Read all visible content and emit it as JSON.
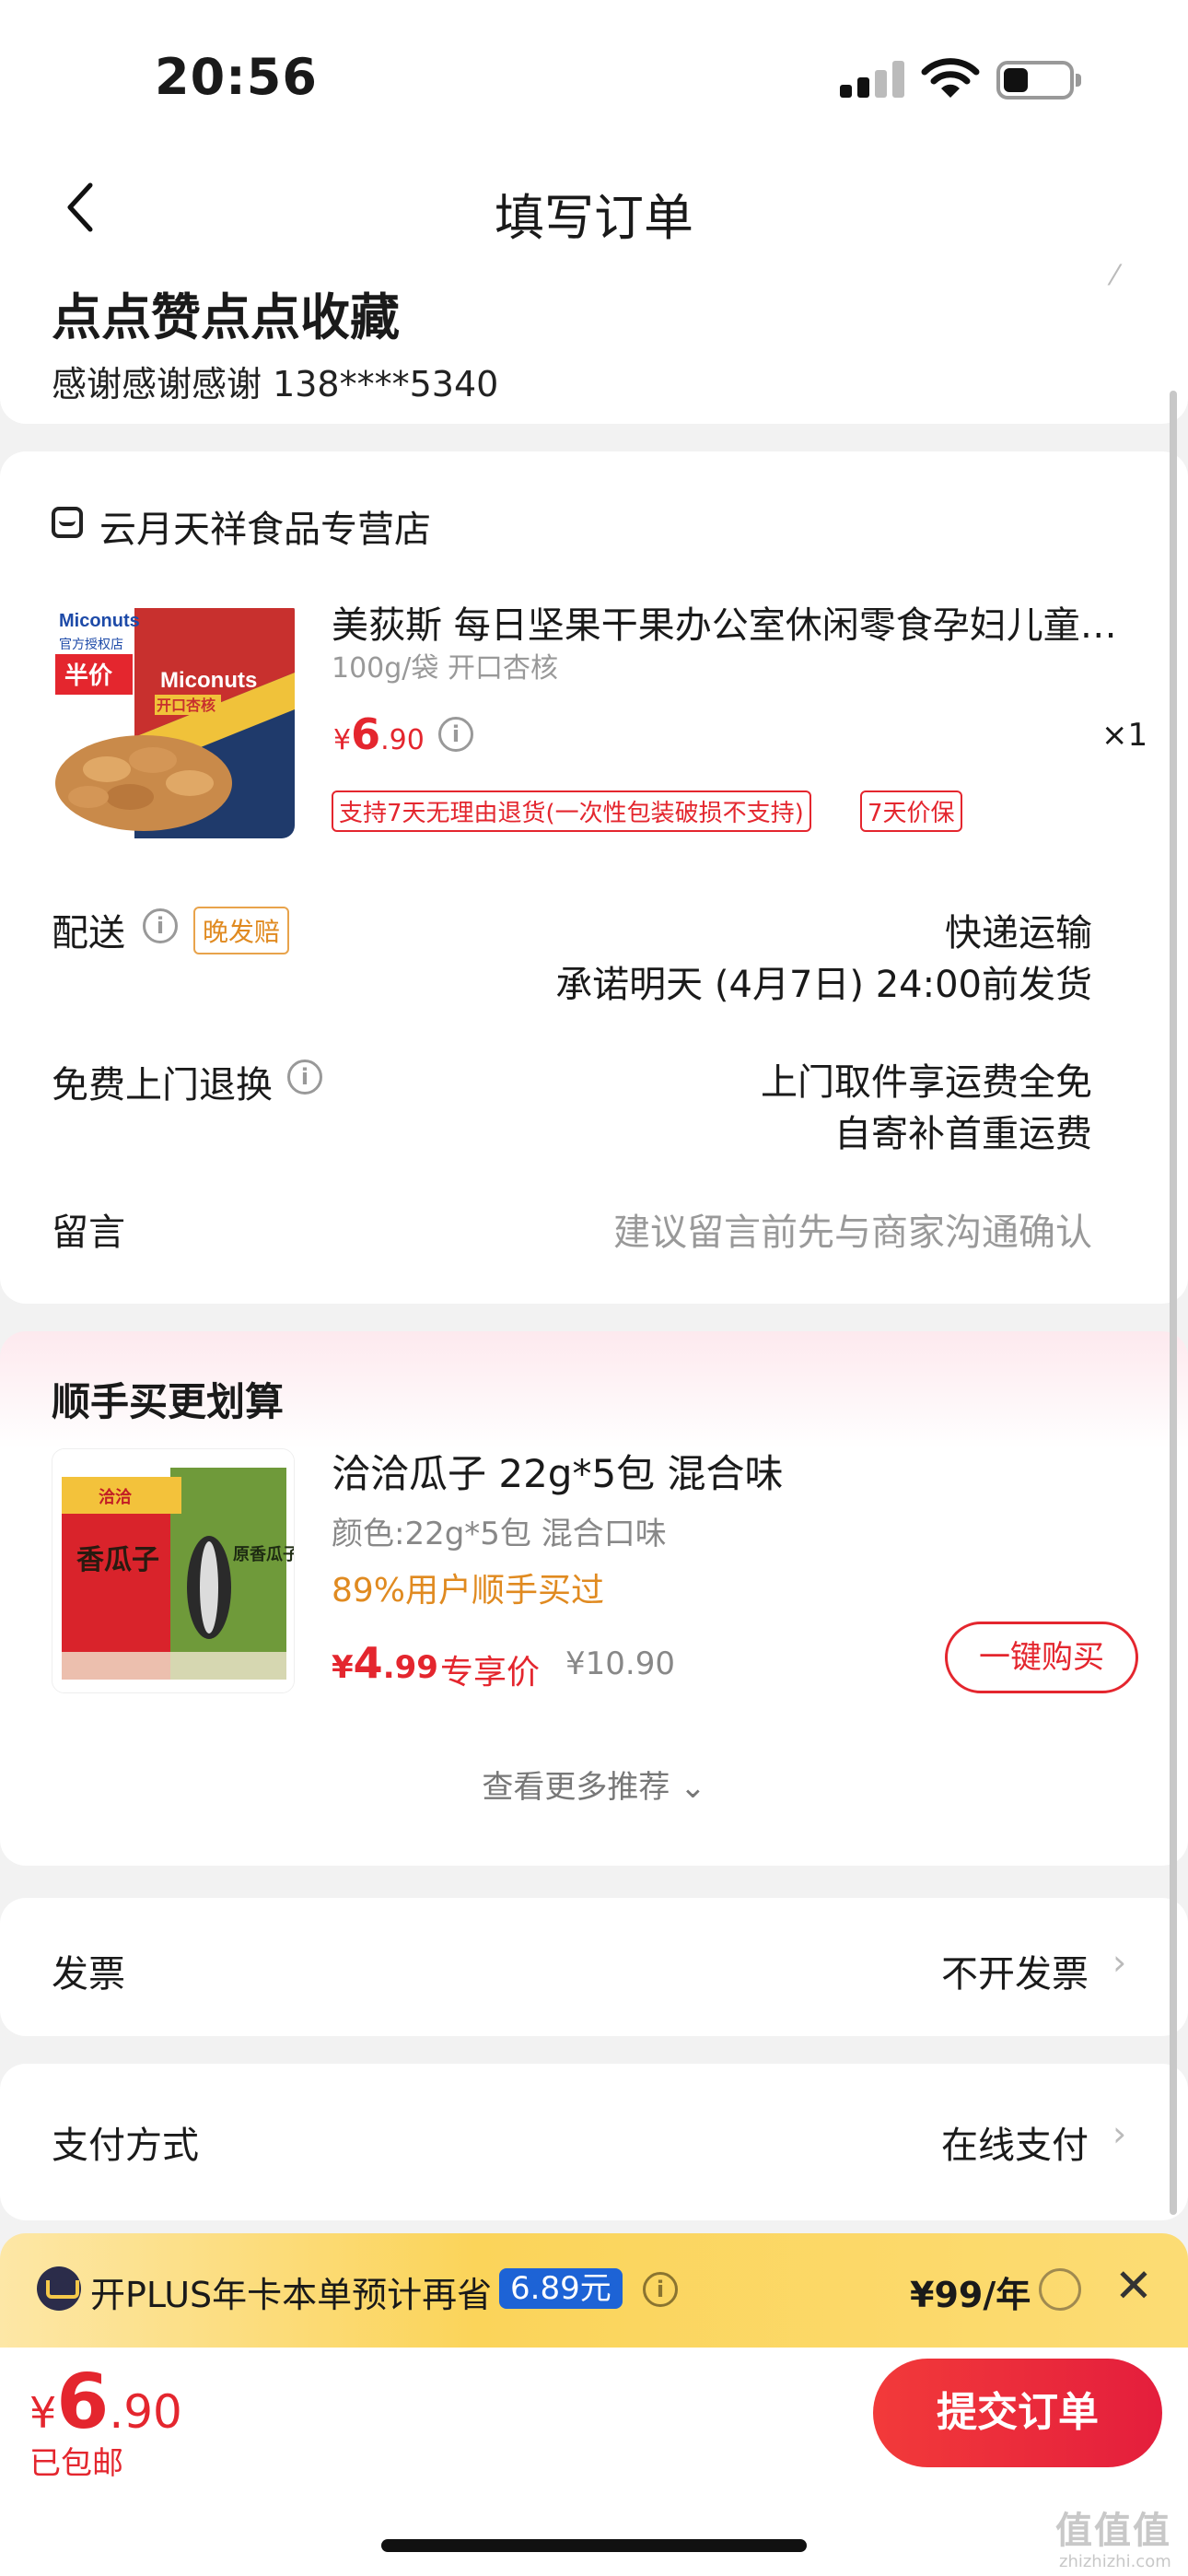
{
  "status_bar": {
    "time": "20:56"
  },
  "nav": {
    "title": "填写订单"
  },
  "address": {
    "name": "点点赞点点收藏",
    "contact": "感谢感谢感谢  138****5340"
  },
  "store": {
    "name": "云月天祥食品专营店"
  },
  "product": {
    "title": "美荻斯 每日坚果干果办公室休闲零食孕妇儿童…",
    "spec": "100g/袋 开口杏核",
    "price_symbol": "¥",
    "price_int": "6",
    "price_dec": ".90",
    "quantity": "×1",
    "tags": [
      "支持7天无理由退货(一次性包装破损不支持)",
      "7天价保"
    ],
    "image_brand": "Miconuts",
    "image_badge": "半价",
    "image_store_label": "官方授权店",
    "image_flavor": "开口杏核"
  },
  "delivery": {
    "label": "配送",
    "tag": "晚发赔",
    "method": "快递运输",
    "promise": "承诺明天 (4月7日) 24:00前发货"
  },
  "return_service": {
    "label": "免费上门退换",
    "line1": "上门取件享运费全免",
    "line2": "自寄补首重运费"
  },
  "message": {
    "label": "留言",
    "placeholder": "建议留言前先与商家沟通确认"
  },
  "recommend": {
    "title": "顺手买更划算",
    "name": "洽洽瓜子 22g*5包 混合味",
    "spec": "颜色:22g*5包 混合口味",
    "bought_pct": "89%用户顺手买过",
    "price_symbol": "¥",
    "price_int": "4",
    "price_dec": ".99",
    "exclusive_label": "专享价",
    "original_price": "¥10.90",
    "buy_label": "一键购买",
    "more_label": "查看更多推荐 ⌄",
    "image_brand": "洽洽",
    "image_text_left": "香瓜子",
    "image_text_right": "原香瓜子"
  },
  "invoice": {
    "label": "发票",
    "value": "不开发票"
  },
  "payment": {
    "label": "支付方式",
    "value": "在线支付"
  },
  "plus": {
    "text": "开PLUS年卡本单预计再省",
    "amount": "6.89元",
    "price": "¥99/年"
  },
  "bottom": {
    "price_symbol": "¥",
    "price_int": "6",
    "price_dec": ".90",
    "shipping": "已包邮",
    "submit_label": "提交订单"
  },
  "watermark": {
    "text": "值值值",
    "sub": "zhizhizhi.com"
  },
  "colors": {
    "accent_red": "#e4262e",
    "orange": "#e08a20",
    "plus_blue": "#1d63d6",
    "plus_gold": "#fbd45a"
  }
}
